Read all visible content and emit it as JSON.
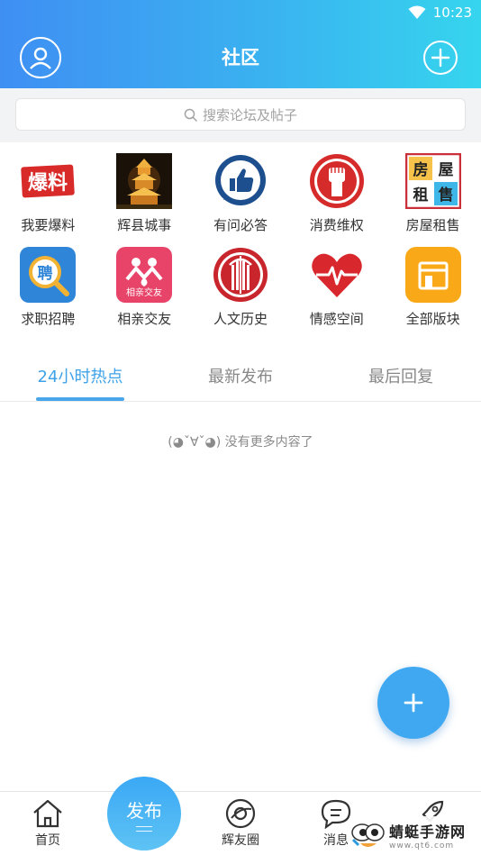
{
  "status": {
    "time": "10:23"
  },
  "header": {
    "title": "社区"
  },
  "search": {
    "placeholder": "搜索论坛及帖子"
  },
  "grid": [
    {
      "label": "我要爆料",
      "icon": "baoliao-icon",
      "text": "爆料"
    },
    {
      "label": "辉县城事",
      "icon": "pagoda-photo-icon"
    },
    {
      "label": "有问必答",
      "icon": "thumbs-up-icon"
    },
    {
      "label": "消费维权",
      "icon": "raised-fist-icon"
    },
    {
      "label": "房屋租售",
      "icon": "house-rent-icon",
      "chars": [
        "房",
        "屋",
        "租",
        "售"
      ]
    },
    {
      "label": "求职招聘",
      "icon": "recruit-magnifier-icon",
      "text": "聘"
    },
    {
      "label": "相亲交友",
      "icon": "dating-icon",
      "text": "相亲交友"
    },
    {
      "label": "人文历史",
      "icon": "history-building-icon"
    },
    {
      "label": "情感空间",
      "icon": "heart-pulse-icon"
    },
    {
      "label": "全部版块",
      "icon": "shop-icon"
    }
  ],
  "tabs": [
    {
      "label": "24小时热点",
      "active": true
    },
    {
      "label": "最新发布",
      "active": false
    },
    {
      "label": "最后回复",
      "active": false
    }
  ],
  "feed": {
    "empty_text": "(◕ˇ∀ˇ◕) 没有更多内容了"
  },
  "bottom_nav": {
    "home": "首页",
    "publish": "发布",
    "friends": "辉友圈",
    "messages": "消息"
  },
  "watermark": {
    "name": "蜻蜓手游网",
    "url": "www.qt6.com"
  },
  "colors": {
    "accent": "#3fa2e8",
    "header_start": "#3f8ff3",
    "header_end": "#36d5ee"
  }
}
